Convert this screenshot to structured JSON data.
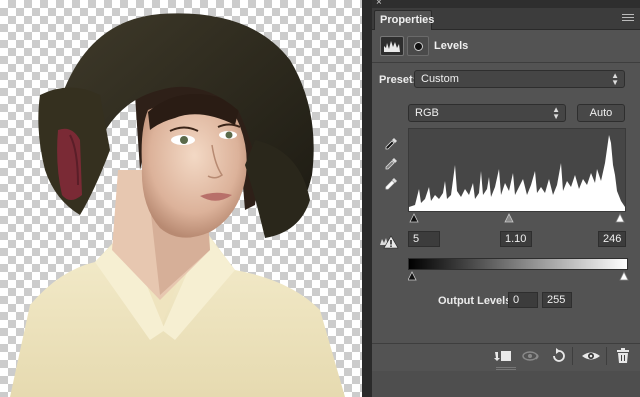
{
  "panel": {
    "close_glyph": "×",
    "tab_label": "Properties",
    "adjustment_title": "Levels",
    "adjustment_icon": "levels-histogram-icon",
    "mask_icon": "mask-icon"
  },
  "preset": {
    "label": "Preset:",
    "value": "Custom"
  },
  "channel": {
    "value": "RGB"
  },
  "auto_button": "Auto",
  "eyedroppers": [
    "black-point-eyedropper-icon",
    "gray-point-eyedropper-icon",
    "white-point-eyedropper-icon"
  ],
  "input_levels": {
    "black": "5",
    "gamma": "1.10",
    "white": "246"
  },
  "output_levels": {
    "label": "Output Levels:",
    "black": "0",
    "white": "255"
  },
  "bottom_bar_icons": [
    "clip-to-layer-icon",
    "view-previous-state-icon",
    "reset-icon",
    "visibility-eye-icon",
    "trash-icon"
  ],
  "colors": {
    "panel_bg": "#535353",
    "field_bg": "#3c3c3c",
    "text": "#f0f0f0",
    "histogram_fill": "#ffffff",
    "canvas_checker": "#cccccc"
  }
}
